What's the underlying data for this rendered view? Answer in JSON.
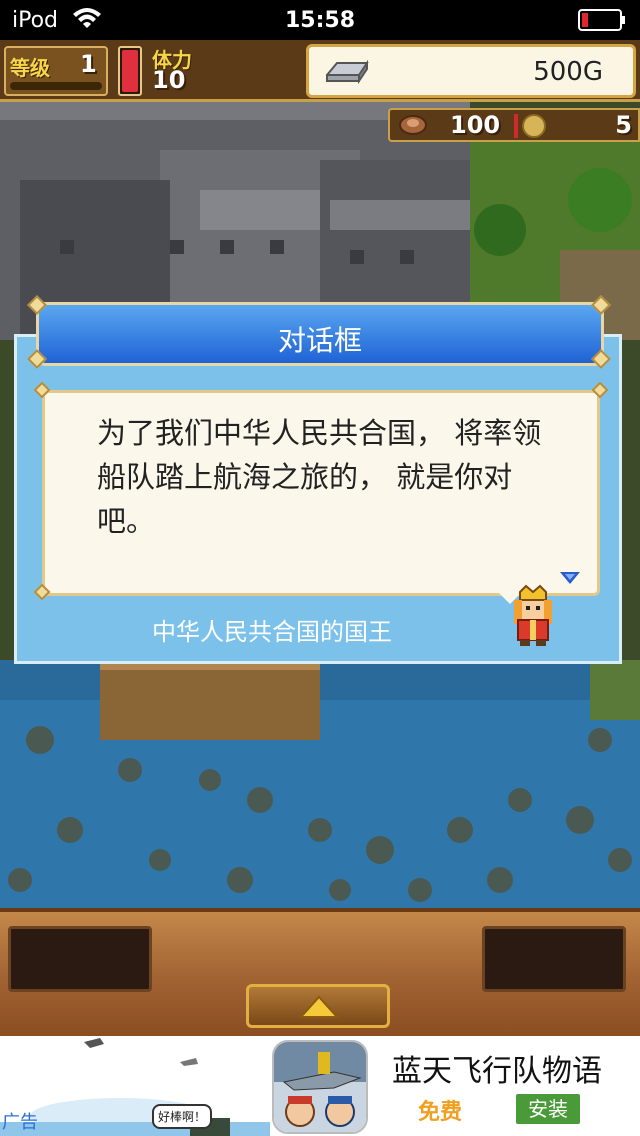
{
  "status_bar": {
    "carrier": "iPod",
    "time": "15:58"
  },
  "hud": {
    "level_label": "等级",
    "level_value": "1",
    "stamina_label": "体力",
    "stamina_value": "10",
    "stamina_fill": 1.0,
    "gold_value": "500G",
    "food_value": "100",
    "right_value": "5"
  },
  "dialog": {
    "title": "对话框",
    "message": "为了我们中华人民共合国， 将率领船队踏上航海之旅的， 就是你对吧。",
    "speaker": "中华人民共合国的国王"
  },
  "ad": {
    "label": "广告",
    "bubble_text": "好棒啊！",
    "app_title": "蓝天飞行队物语",
    "price": "免费",
    "install_label": "安装"
  },
  "colors": {
    "dialog_bg": "#7cc1ea",
    "title_bar": "#1f63d6",
    "hud_brown": "#5a3a17",
    "install_green": "#4a9a3a",
    "free_orange": "#f0a020"
  }
}
